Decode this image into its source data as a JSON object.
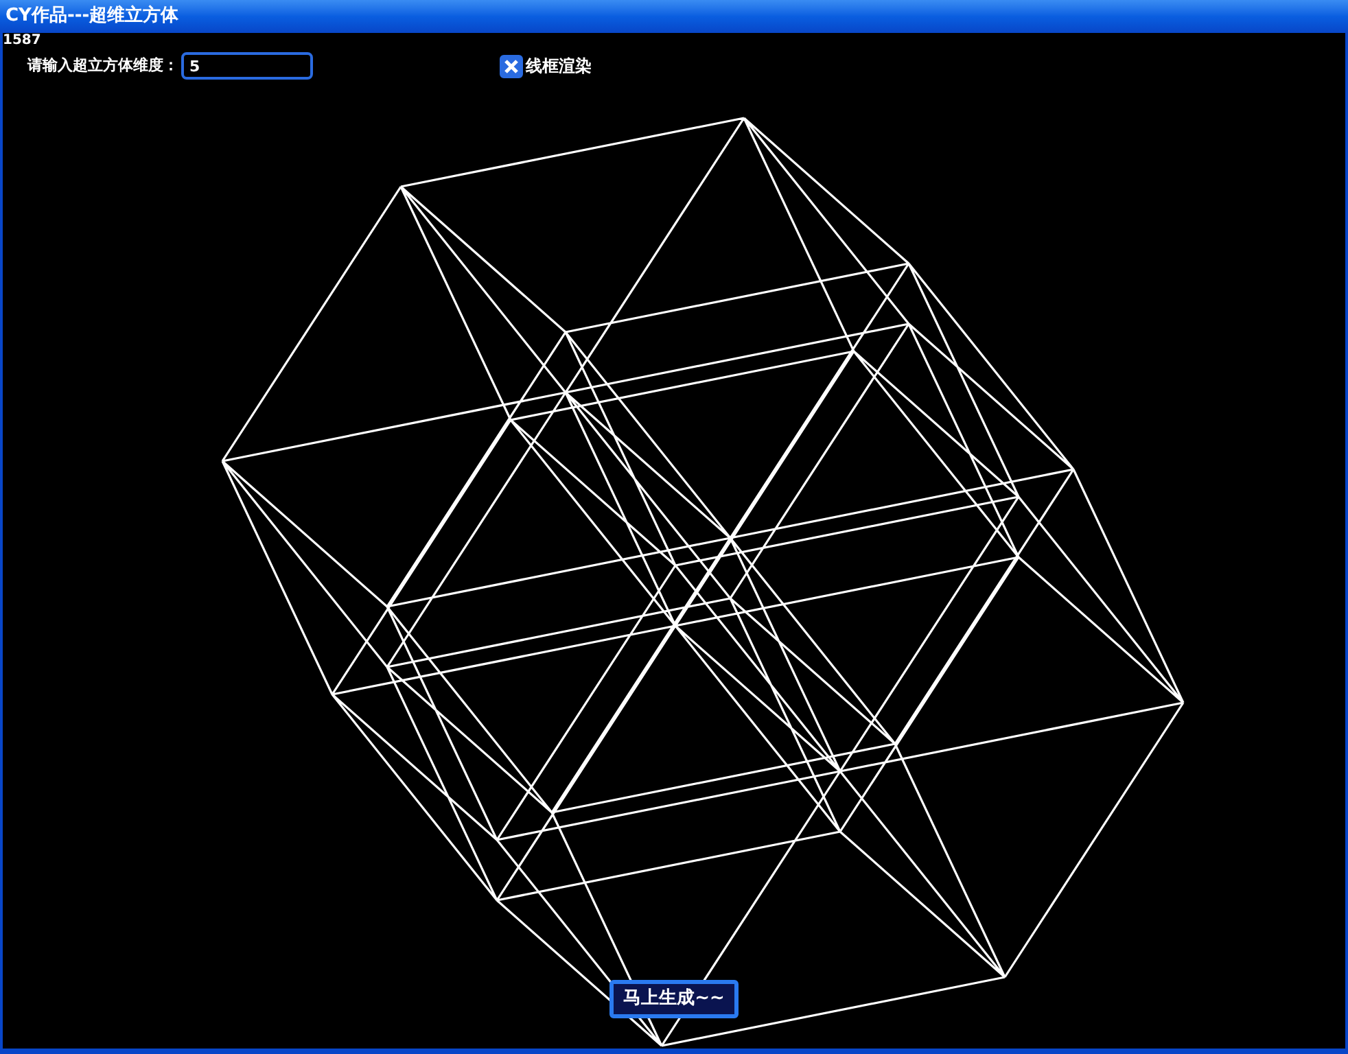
{
  "window": {
    "title": "CY作品---超维立方体"
  },
  "counter": "1587",
  "dimension_field": {
    "label": "请输入超立方体维度：",
    "value": "5"
  },
  "wireframe_checkbox": {
    "label": "线框渲染",
    "checked": true
  },
  "generate_button": {
    "label": "马上生成~~"
  }
}
